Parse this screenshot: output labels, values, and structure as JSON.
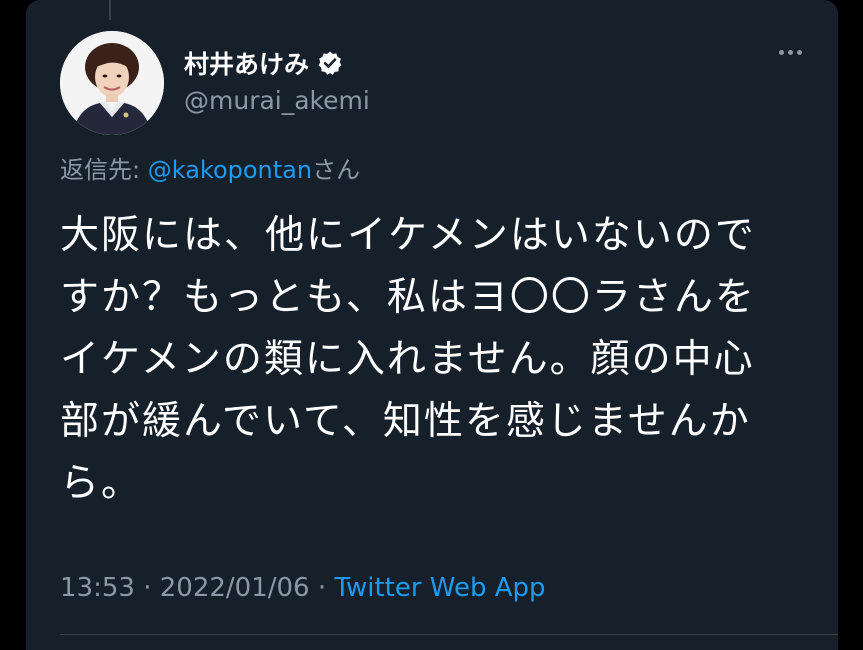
{
  "tweet": {
    "display_name": "村井あけみ",
    "handle": "@murai_akemi",
    "verified_icon": "verified-badge-icon",
    "more_icon": "more-options-icon",
    "reply_prefix": "返信先: ",
    "reply_to": "@kakopontan",
    "reply_suffix": "さん",
    "text": "大阪には、他にイケメンはいないので\nすか？もっとも、私はヨ〇〇ラさんを\nイケメンの類に入れません。顔の中心\n部が緩んでいて、知性を感じませんか\nら。",
    "time": "13:53",
    "sep1": " · ",
    "date": "2022/01/06",
    "sep2": " · ",
    "app": "Twitter Web App"
  },
  "colors": {
    "background": "#15202b",
    "text": "#ffffff",
    "secondary": "#8b98a5",
    "accent": "#1d9bf0"
  }
}
